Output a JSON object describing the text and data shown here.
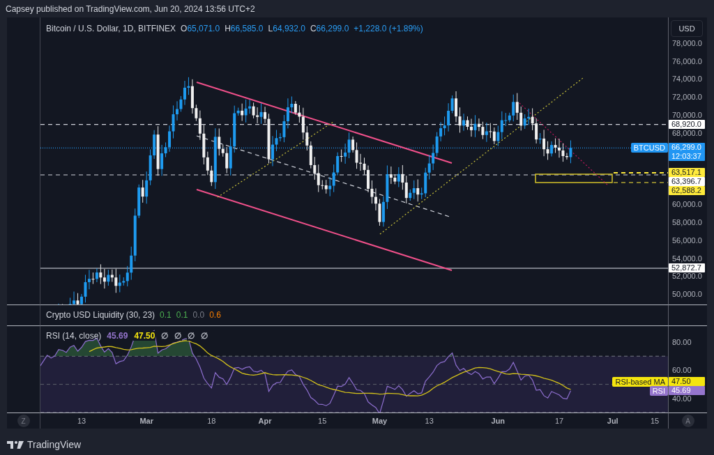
{
  "attribution": "Capsey published on TradingView.com, Jun 20, 2024 13:56 UTC+2",
  "legend": {
    "symbol": "Bitcoin / U.S. Dollar, 1D, BITFINEX",
    "ohlc": [
      {
        "label": "O",
        "value": "65,071.0"
      },
      {
        "label": "H",
        "value": "66,585.0"
      },
      {
        "label": "L",
        "value": "64,932.0"
      },
      {
        "label": "C",
        "value": "66,299.0"
      }
    ],
    "change": "+1,228.0 (+1.89%)"
  },
  "currency_button": "USD",
  "price_ticks": [
    "78,000.0",
    "76,000.0",
    "74,000.0",
    "72,000.0",
    "70,000.0",
    "68,000.0",
    "60,000.0",
    "58,000.0",
    "56,000.0",
    "54,000.0",
    "52,000.0",
    "50,000.0"
  ],
  "price_labels": [
    {
      "kind": "level",
      "text": "68,920.0",
      "color": "#ffffff"
    },
    {
      "kind": "last",
      "tag": "BTCUSD",
      "text": "66,299.0",
      "countdown": "12:03:37",
      "color": "#2196f3"
    },
    {
      "kind": "level",
      "text": "63,517.1",
      "color": "#ffeb3b"
    },
    {
      "kind": "level",
      "text": "63,396.7",
      "color": "#ffffff"
    },
    {
      "kind": "level",
      "text": "62,588.2",
      "color": "#ffeb3b"
    },
    {
      "kind": "level",
      "text": "52,872.7",
      "color": "#ffffff"
    }
  ],
  "liquidity": {
    "title": "Crypto USD Liquidity (30, 23)",
    "values": [
      {
        "text": "0.1",
        "color": "#4caf50"
      },
      {
        "text": "0.1",
        "color": "#4caf50"
      },
      {
        "text": "0.0",
        "color": "#787b86"
      },
      {
        "text": "0.6",
        "color": "#f57c00"
      }
    ]
  },
  "rsi": {
    "title": "RSI (14, close)",
    "values": [
      {
        "text": "45.69",
        "color": "#9575cd"
      },
      {
        "text": "47.50",
        "color": "#f5e50f"
      },
      {
        "text": "∅",
        "color": "#b2b5be"
      },
      {
        "text": "∅",
        "color": "#b2b5be"
      },
      {
        "text": "∅",
        "color": "#b2b5be"
      },
      {
        "text": "∅",
        "color": "#b2b5be"
      }
    ],
    "ticks": [
      "80.00",
      "60.00",
      "40.00"
    ],
    "tags": [
      {
        "name": "RSI-based MA",
        "value": "47.50",
        "color": "#f5e50f"
      },
      {
        "name": "RSI",
        "value": "45.69",
        "color": "#9575cd"
      }
    ]
  },
  "time_axis": [
    {
      "text": "13",
      "kind": "day"
    },
    {
      "text": "Mar",
      "kind": "month"
    },
    {
      "text": "18",
      "kind": "day"
    },
    {
      "text": "Apr",
      "kind": "month"
    },
    {
      "text": "15",
      "kind": "day"
    },
    {
      "text": "May",
      "kind": "month"
    },
    {
      "text": "13",
      "kind": "day"
    },
    {
      "text": "Jun",
      "kind": "month"
    },
    {
      "text": "17",
      "kind": "day"
    },
    {
      "text": "Jul",
      "kind": "month"
    },
    {
      "text": "15",
      "kind": "day"
    }
  ],
  "corner_buttons": [
    "Z",
    "A"
  ],
  "logo": "TradingView"
}
